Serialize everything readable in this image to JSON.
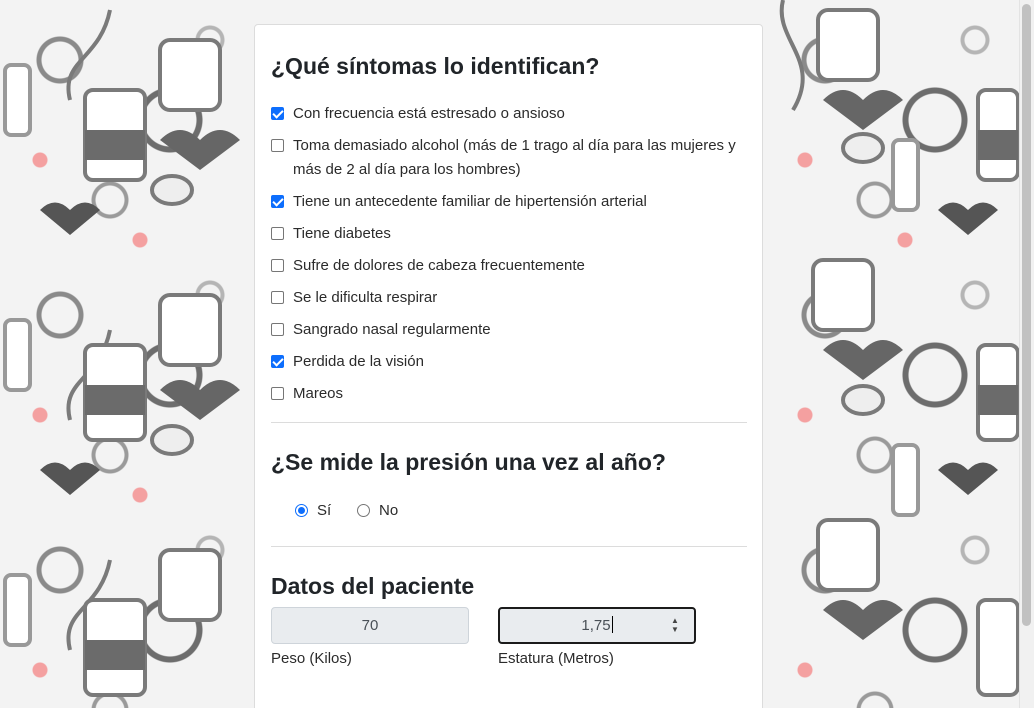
{
  "symptoms": {
    "title": "¿Qué síntomas lo identifican?",
    "items": [
      {
        "label": "Con frecuencia está estresado o ansioso",
        "checked": true
      },
      {
        "label": "Toma demasiado alcohol (más de 1 trago al día para las mujeres y más de 2 al día para los hombres)",
        "checked": false
      },
      {
        "label": "Tiene un antecedente familiar de hipertensión arterial",
        "checked": true
      },
      {
        "label": "Tiene diabetes",
        "checked": false
      },
      {
        "label": "Sufre de dolores de cabeza frecuentemente",
        "checked": false
      },
      {
        "label": "Se le dificulta respirar",
        "checked": false
      },
      {
        "label": "Sangrado nasal regularmente",
        "checked": false
      },
      {
        "label": "Perdida de la visión",
        "checked": true
      },
      {
        "label": "Mareos",
        "checked": false
      }
    ]
  },
  "pressure": {
    "title": "¿Se mide la presión una vez al año?",
    "options": [
      {
        "label": "Sí",
        "selected": true
      },
      {
        "label": "No",
        "selected": false
      }
    ]
  },
  "patient": {
    "title": "Datos del paciente",
    "weight": {
      "value": "70",
      "label": "Peso (Kilos)"
    },
    "height": {
      "value": "1,75",
      "label": "Estatura (Metros)"
    }
  },
  "colors": {
    "accent": "#0d6efd",
    "card": "#ffffff",
    "field_bg": "#e9ecef"
  }
}
